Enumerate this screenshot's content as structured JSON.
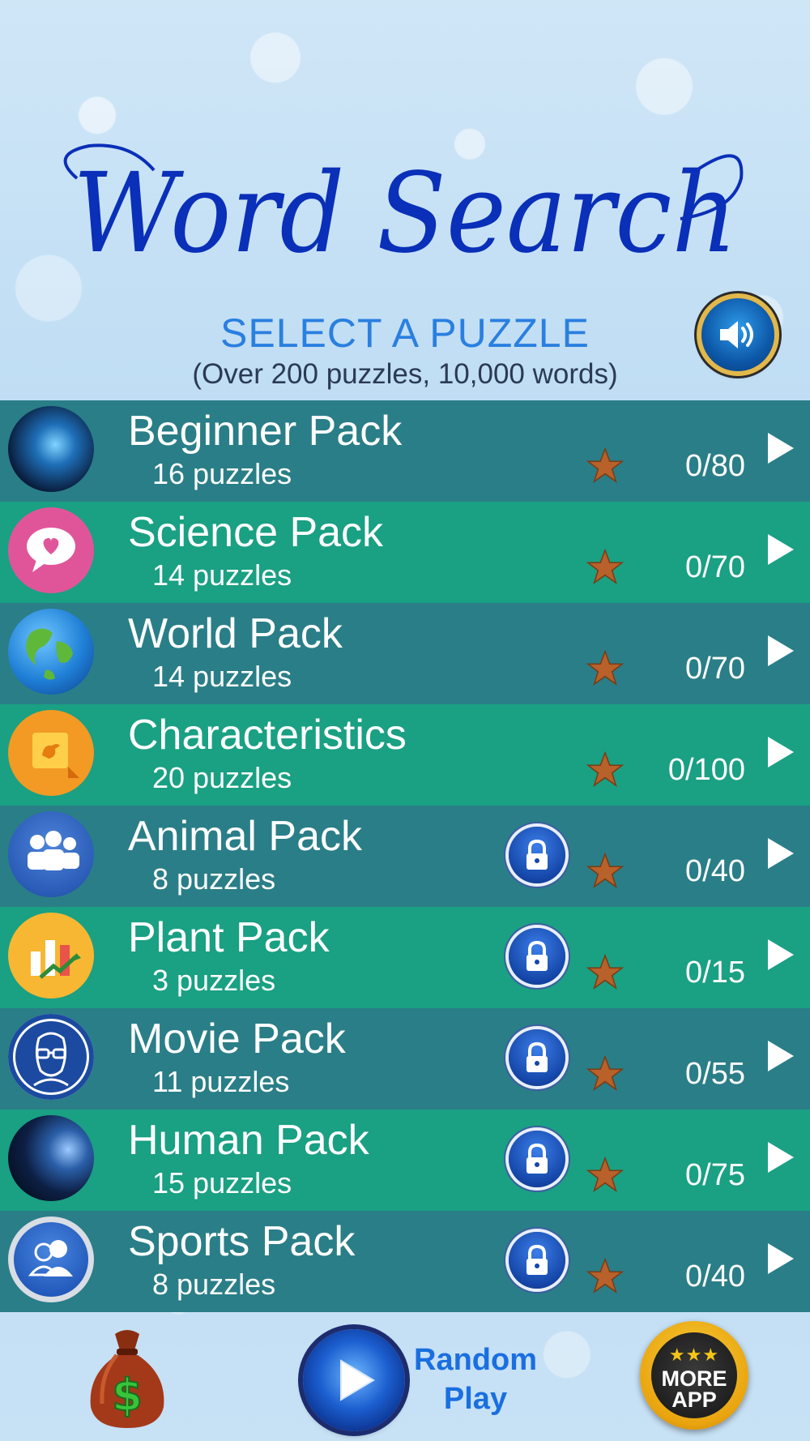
{
  "header": {
    "title": "Word Search",
    "subtitle": "SELECT A PUZZLE",
    "note": "(Over 200 puzzles, 10,000 words)"
  },
  "sound": {
    "icon": "speaker-icon"
  },
  "packs": [
    {
      "name": "Beginner Pack",
      "count": "16 puzzles",
      "progress": "0/80",
      "locked": false,
      "icon": "nebula-icon"
    },
    {
      "name": "Science Pack",
      "count": "14 puzzles",
      "progress": "0/70",
      "locked": false,
      "icon": "heart-bubble-icon"
    },
    {
      "name": "World Pack",
      "count": "14 puzzles",
      "progress": "0/70",
      "locked": false,
      "icon": "globe-icon"
    },
    {
      "name": "Characteristics",
      "count": "20 puzzles",
      "progress": "0/100",
      "locked": false,
      "icon": "bird-note-icon"
    },
    {
      "name": "Animal Pack",
      "count": "8 puzzles",
      "progress": "0/40",
      "locked": true,
      "icon": "people-group-icon"
    },
    {
      "name": "Plant Pack",
      "count": "3 puzzles",
      "progress": "0/15",
      "locked": true,
      "icon": "bar-chart-icon"
    },
    {
      "name": "Movie Pack",
      "count": "11 puzzles",
      "progress": "0/55",
      "locked": true,
      "icon": "face-glasses-icon"
    },
    {
      "name": "Human Pack",
      "count": "15 puzzles",
      "progress": "0/75",
      "locked": true,
      "icon": "planet-icon"
    },
    {
      "name": "Sports Pack",
      "count": "8 puzzles",
      "progress": "0/40",
      "locked": true,
      "icon": "contacts-icon"
    }
  ],
  "bottom": {
    "random_label_1": "Random",
    "random_label_2": "Play",
    "more_label_1": "MORE",
    "more_label_2": "APP",
    "more_stars": "★★★"
  },
  "colors": {
    "row_dark": "#2a7e87",
    "row_light": "#1aa083",
    "title": "#0a2fb8",
    "subtitle": "#2a7fe0",
    "star": "#b8612a"
  }
}
